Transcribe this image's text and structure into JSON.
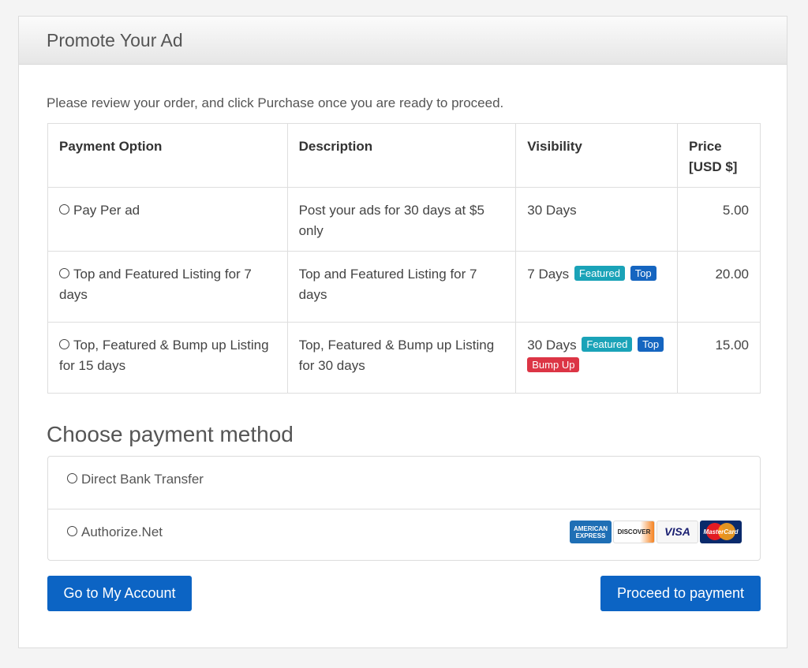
{
  "panel": {
    "title": "Promote Your Ad"
  },
  "intro": "Please review your order, and click Purchase once you are ready to proceed.",
  "table": {
    "headers": [
      "Payment Option",
      "Description",
      "Visibility",
      "Price\n[USD $]"
    ],
    "header_price_line1": "Price",
    "header_price_line2": "[USD $]",
    "rows": [
      {
        "option": "Pay Per ad",
        "description": "Post your ads for 30 days at $5 only",
        "visibility": "30 Days",
        "badges": [],
        "price": "5.00"
      },
      {
        "option": "Top and Featured Listing for 7 days",
        "description": "Top and Featured Listing for 7 days",
        "visibility": "7 Days",
        "badges": [
          "Featured",
          "Top"
        ],
        "price": "20.00"
      },
      {
        "option": "Top, Featured & Bump up Listing for 15 days",
        "description": "Top, Featured & Bump up Listing for 30 days",
        "visibility": "30 Days",
        "badges": [
          "Featured",
          "Top",
          "Bump Up"
        ],
        "price": "15.00"
      }
    ]
  },
  "payment": {
    "title": "Choose payment method",
    "methods": [
      "Direct Bank Transfer",
      "Authorize.Net"
    ],
    "card_logos": [
      "amex-logo",
      "discover-logo",
      "visa-logo",
      "mastercard-logo"
    ],
    "card_logo_text": {
      "amex": "AMERICAN EXPRESS",
      "discover": "DISCOVER",
      "visa": "VISA",
      "mastercard": "MasterCard"
    }
  },
  "buttons": {
    "account": "Go to My Account",
    "proceed": "Proceed to payment"
  },
  "colors": {
    "primary": "#0c64c4",
    "badge_featured": "#1aa3b8",
    "badge_top": "#1565c0",
    "badge_bump": "#dc3545"
  }
}
